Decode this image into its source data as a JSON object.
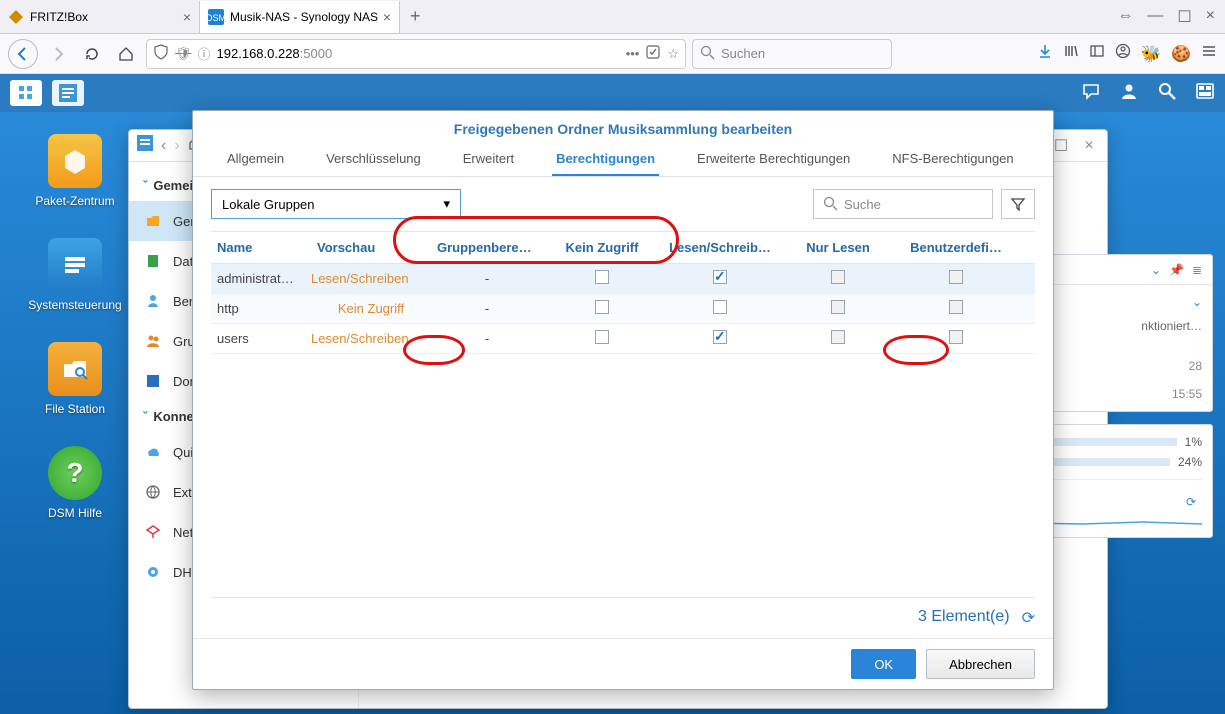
{
  "browser": {
    "tabs": [
      {
        "title": "FRITZ!Box",
        "active": false
      },
      {
        "title": "Musik-NAS - Synology NAS",
        "active": true
      }
    ],
    "url_prefix": "192.168.0.228",
    "url_suffix": ":5000",
    "search_placeholder": "Suchen"
  },
  "desktop_icons": [
    {
      "label": "Paket-Zentrum"
    },
    {
      "label": "Systemsteuerung"
    },
    {
      "label": "File Station"
    },
    {
      "label": "DSM Hilfe"
    }
  ],
  "control_panel": {
    "section1": "Gemeinsame Ordner",
    "section2": "Konnektivität",
    "items": [
      "Gemeinsame Ordner",
      "Dateidienste",
      "Benutzer",
      "Gruppe",
      "Domain/LDAP"
    ],
    "items2": [
      "QuickConnect",
      "Externer Zugriff",
      "Netzwerk",
      "DHCP-Server"
    ]
  },
  "widgets": {
    "log_text": "nktioniert…",
    "time1": "28",
    "time2": "15:55",
    "cpu": "1%",
    "ram": "24%"
  },
  "dialog": {
    "title": "Freigegebenen Ordner Musiksammlung bearbeiten",
    "tabs": [
      "Allgemein",
      "Verschlüsselung",
      "Erweitert",
      "Berechtigungen",
      "Erweiterte Berechtigungen",
      "NFS-Berechtigungen"
    ],
    "active_tab_index": 3,
    "dropdown_value": "Lokale Gruppen",
    "search_placeholder": "Suche",
    "columns": [
      "Name",
      "Vorschau",
      "Gruppenberec…",
      "Kein Zugriff",
      "Lesen/Schreib…",
      "Nur Lesen",
      "Benutzerdefi…"
    ],
    "rows": [
      {
        "name": "administrat…",
        "preview": "Lesen/Schreiben",
        "group": "-",
        "no_access": false,
        "rw": true,
        "ro": false,
        "custom": false
      },
      {
        "name": "http",
        "preview": "Kein Zugriff",
        "group": "-",
        "no_access": false,
        "rw": false,
        "ro": false,
        "custom": false
      },
      {
        "name": "users",
        "preview": "Lesen/Schreiben",
        "group": "-",
        "no_access": false,
        "rw": true,
        "ro": false,
        "custom": false
      }
    ],
    "count_label": "3 Element(e)",
    "ok_label": "OK",
    "cancel_label": "Abbrechen"
  }
}
